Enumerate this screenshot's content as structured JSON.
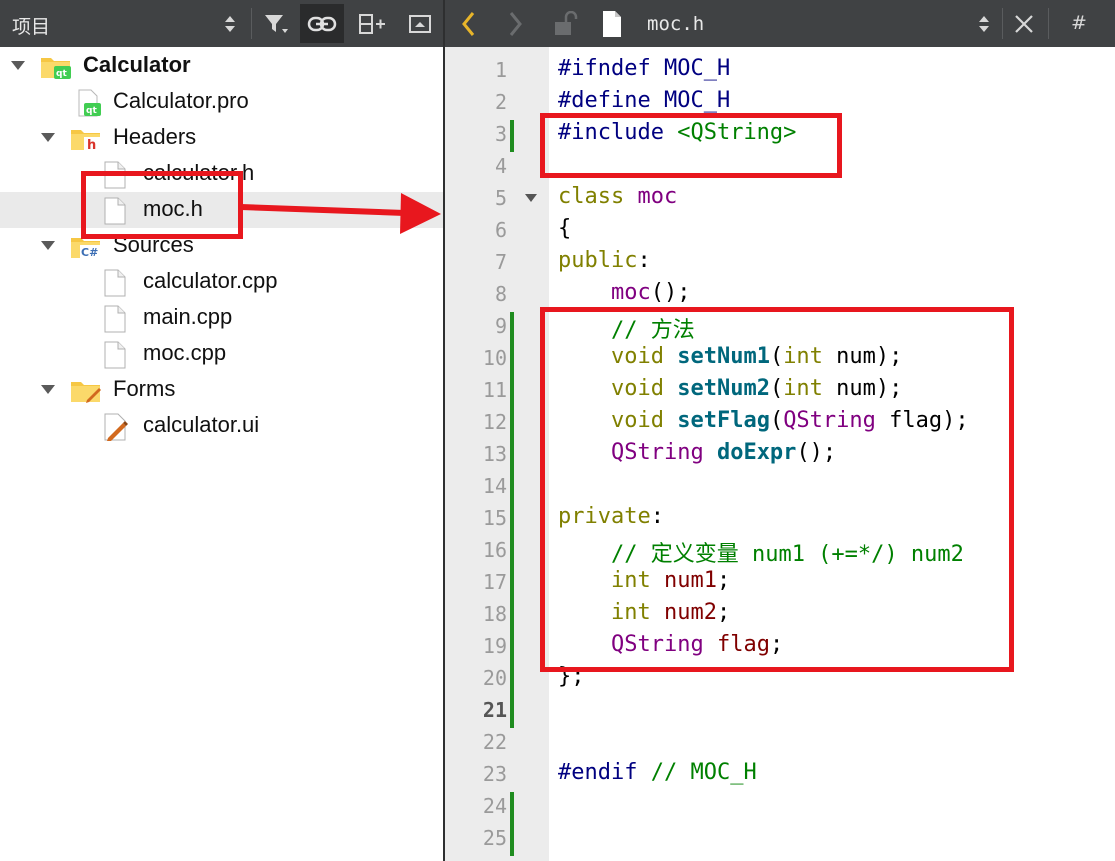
{
  "project_panel": {
    "title": "项目",
    "tree": [
      {
        "label": "Calculator",
        "icon": "qt-project-folder-icon",
        "bold": true
      },
      {
        "label": "Calculator.pro",
        "icon": "qt-pro-file-icon"
      },
      {
        "label": "Headers",
        "icon": "headers-folder-icon"
      },
      {
        "label": "calculator.h",
        "icon": "file-icon"
      },
      {
        "label": "moc.h",
        "icon": "file-icon",
        "selected": true
      },
      {
        "label": "Sources",
        "icon": "sources-folder-icon"
      },
      {
        "label": "calculator.cpp",
        "icon": "file-icon"
      },
      {
        "label": "main.cpp",
        "icon": "file-icon"
      },
      {
        "label": "moc.cpp",
        "icon": "file-icon"
      },
      {
        "label": "Forms",
        "icon": "forms-folder-icon"
      },
      {
        "label": "calculator.ui",
        "icon": "ui-file-icon"
      }
    ]
  },
  "editor": {
    "file_name": "moc.h",
    "symbol_button": "#",
    "current_line": 21,
    "lines": [
      "#ifndef MOC_H",
      "#define MOC_H",
      "#include <QString>",
      "",
      "class moc",
      "{",
      "public:",
      "    moc();",
      "    // 方法",
      "    void setNum1(int num);",
      "    void setNum2(int num);",
      "    void setFlag(QString flag);",
      "    QString doExpr();",
      "",
      "private:",
      "    // 定义变量 num1 (+=*/) num2",
      "    int num1;",
      "    int num2;",
      "    QString flag;",
      "};",
      "",
      "",
      "#endif // MOC_H",
      "",
      ""
    ]
  },
  "colors": {
    "toolbar": "#404244",
    "highlight_box": "#e8171e",
    "change_marker": "#1f8c1f",
    "keyword": "#808000",
    "preprocessor": "#000080",
    "type": "#800080",
    "function": "#00677c"
  }
}
